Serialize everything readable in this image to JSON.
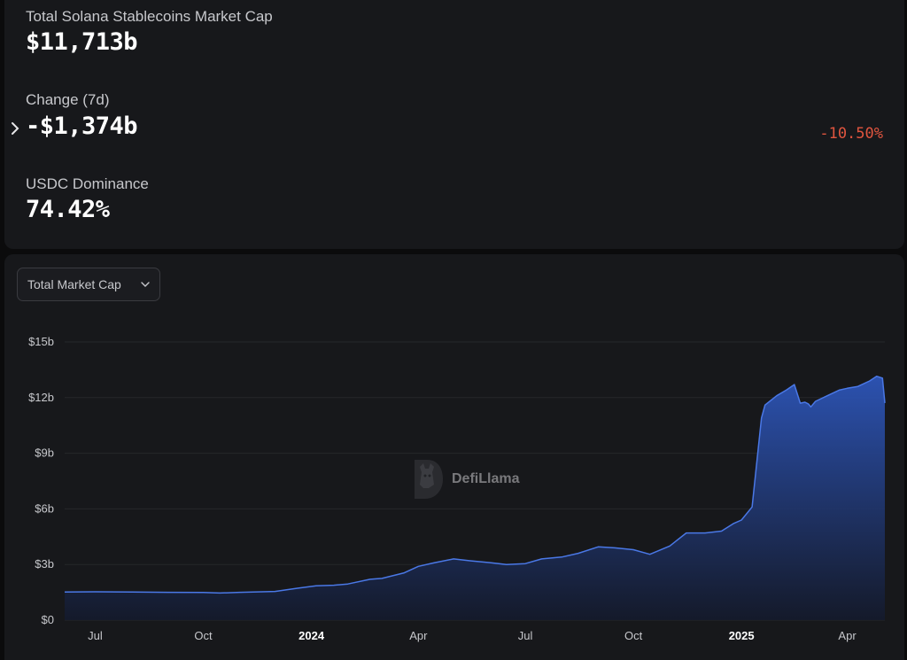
{
  "stats": {
    "market_cap": {
      "label": "Total Solana Stablecoins Market Cap",
      "value": "$11,713b"
    },
    "change": {
      "label": "Change (7d)",
      "value": "-$1,374b",
      "percent": "-10.50%"
    },
    "dominance": {
      "label": "USDC Dominance",
      "value": "74.42%"
    }
  },
  "chart_controls": {
    "metric_select": "Total Market Cap"
  },
  "watermark": {
    "text": "DefiLlama"
  },
  "colors": {
    "line": "#4a78e6",
    "fill_top": "#2d55b8",
    "fill_bottom": "#141a2c",
    "negative": "#e0553f",
    "panel": "#17181b"
  },
  "chart_data": {
    "type": "area",
    "title": "",
    "xlabel": "",
    "ylabel": "",
    "ylim": [
      0,
      15
    ],
    "y_unit": "billion USD",
    "y_ticks": [
      "$0",
      "$3b",
      "$6b",
      "$9b",
      "$12b",
      "$15b"
    ],
    "y_tick_values": [
      0,
      3,
      6,
      9,
      12,
      15
    ],
    "x_ticks": [
      {
        "label": "Jul",
        "date": "2023-07-01",
        "bold": false
      },
      {
        "label": "Oct",
        "date": "2023-10-01",
        "bold": false
      },
      {
        "label": "2024",
        "date": "2024-01-01",
        "bold": true
      },
      {
        "label": "Apr",
        "date": "2024-04-01",
        "bold": false
      },
      {
        "label": "Jul",
        "date": "2024-07-01",
        "bold": false
      },
      {
        "label": "Oct",
        "date": "2024-10-01",
        "bold": false
      },
      {
        "label": "2025",
        "date": "2025-01-01",
        "bold": true
      },
      {
        "label": "Apr",
        "date": "2025-04-01",
        "bold": false
      }
    ],
    "xlim": [
      "2023-06-05",
      "2025-05-03"
    ],
    "grid": true,
    "series": [
      {
        "x": [
          "2023-06-05",
          "2023-07-01",
          "2023-08-01",
          "2023-09-01",
          "2023-10-01",
          "2023-10-15",
          "2023-11-01",
          "2023-12-01",
          "2023-12-20",
          "2024-01-05",
          "2024-01-20",
          "2024-02-01",
          "2024-02-20",
          "2024-03-01",
          "2024-03-20",
          "2024-04-01",
          "2024-04-15",
          "2024-05-01",
          "2024-05-15",
          "2024-06-01",
          "2024-06-15",
          "2024-07-01",
          "2024-07-15",
          "2024-08-01",
          "2024-08-15",
          "2024-09-01",
          "2024-09-15",
          "2024-10-01",
          "2024-10-15",
          "2024-11-01",
          "2024-11-15",
          "2024-12-01",
          "2024-12-15",
          "2024-12-25",
          "2025-01-01",
          "2025-01-10",
          "2025-01-18",
          "2025-01-21",
          "2025-01-25",
          "2025-01-31",
          "2025-02-08",
          "2025-02-15",
          "2025-02-20",
          "2025-02-24",
          "2025-02-27",
          "2025-03-01",
          "2025-03-05",
          "2025-03-15",
          "2025-03-25",
          "2025-04-01",
          "2025-04-10",
          "2025-04-20",
          "2025-04-26",
          "2025-05-01",
          "2025-05-03"
        ],
        "values": [
          1.52,
          1.53,
          1.52,
          1.5,
          1.49,
          1.46,
          1.5,
          1.55,
          1.72,
          1.85,
          1.88,
          1.95,
          2.2,
          2.25,
          2.55,
          2.9,
          3.1,
          3.3,
          3.2,
          3.1,
          3.0,
          3.05,
          3.3,
          3.4,
          3.6,
          3.95,
          3.9,
          3.8,
          3.55,
          4.0,
          4.7,
          4.7,
          4.8,
          5.2,
          5.4,
          6.1,
          10.9,
          11.6,
          11.8,
          12.1,
          12.4,
          12.7,
          11.7,
          11.75,
          11.65,
          11.5,
          11.8,
          12.1,
          12.4,
          12.5,
          12.6,
          12.9,
          13.15,
          13.05,
          11.71
        ]
      }
    ]
  }
}
